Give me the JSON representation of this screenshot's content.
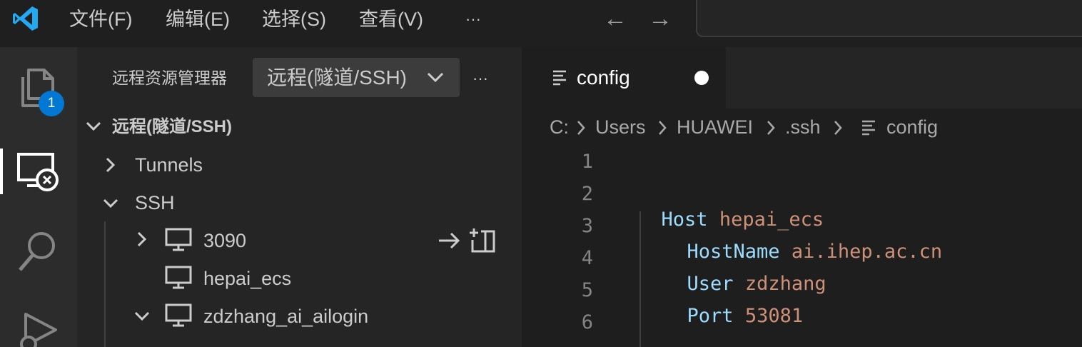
{
  "titlebar": {
    "menus": [
      "文件(F)",
      "编辑(E)",
      "选择(S)",
      "查看(V)"
    ],
    "more": "···",
    "back_arrow": "←",
    "forward_arrow": "→"
  },
  "activity": {
    "explorer_badge": "1"
  },
  "sidebar": {
    "title": "远程资源管理器",
    "dropdown_value": "远程(隧道/SSH)",
    "more": "···",
    "section_title": "远程(隧道/SSH)",
    "tunnels_label": "Tunnels",
    "ssh_label": "SSH",
    "hosts": [
      {
        "label": "3090"
      },
      {
        "label": "hepai_ecs"
      },
      {
        "label": "zdzhang_ai_ailogin"
      }
    ]
  },
  "tab": {
    "label": "config"
  },
  "breadcrumb": {
    "parts": [
      "C:",
      "Users",
      "HUAWEI",
      ".ssh",
      "config"
    ]
  },
  "editor": {
    "line_numbers": [
      "1",
      "2",
      "3",
      "4",
      "5",
      "6"
    ],
    "lines": [
      {
        "key": "",
        "value": ""
      },
      {
        "key": "Host",
        "value": "hepai_ecs"
      },
      {
        "key": "HostName",
        "value": "ai.ihep.ac.cn"
      },
      {
        "key": "User",
        "value": "zdzhang"
      },
      {
        "key": "Port",
        "value": "53081"
      },
      {
        "key": "",
        "value": ""
      }
    ]
  },
  "colors": {
    "accent": "#0078d4",
    "keyword": "#9cdcfe",
    "string": "#ce9178"
  }
}
